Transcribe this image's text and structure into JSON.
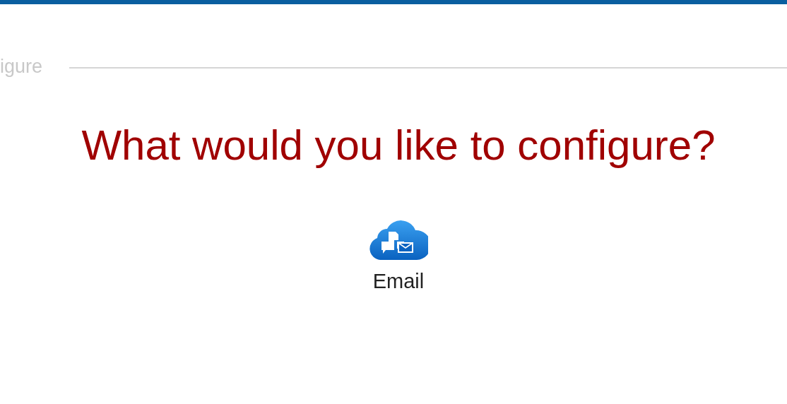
{
  "step_label": "igure",
  "heading": "What would you like to configure?",
  "options": [
    {
      "label": "Email"
    }
  ]
}
